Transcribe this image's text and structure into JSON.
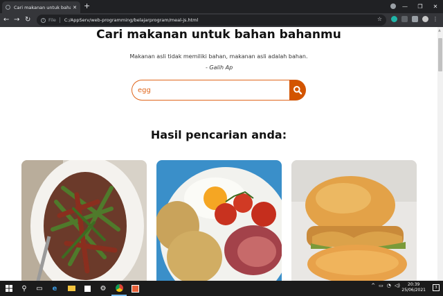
{
  "browser": {
    "tab_title": "Cari makanan untuk bahan baha",
    "tab_close": "✕",
    "new_tab": "+",
    "file_label": "File",
    "url": "C:/AppServ/web-programming/belajarprogram/meal-js.html",
    "window_controls": [
      "—",
      "❐",
      "✕"
    ]
  },
  "page": {
    "title": "Cari makanan untuk bahan bahanmu",
    "quote": "Makanan asli tidak memiliki bahan, makanan asli adalah bahan.",
    "author": "- Galih Ap",
    "search": {
      "value": "egg",
      "placeholder": ""
    },
    "results_heading": "Hasil pencarian anda:",
    "cards": [
      {
        "icon": "steak-stirfry-image"
      },
      {
        "icon": "breakfast-egg-tomato-image"
      },
      {
        "icon": "chicken-burger-image"
      }
    ]
  },
  "taskbar": {
    "time": "20:39",
    "date": "25/06/2021",
    "notification_count": "3"
  },
  "colors": {
    "accent": "#d35400",
    "search_border": "#e0651a"
  }
}
